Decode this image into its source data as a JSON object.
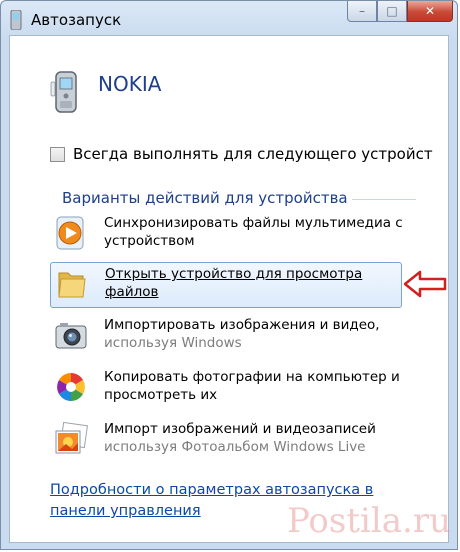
{
  "window": {
    "title": "Автозапуск",
    "caption_buttons": {
      "minimize": "–",
      "maximize": "□",
      "close": "✕"
    }
  },
  "device": {
    "name": "NOKIA",
    "icon": "mobile-phone-icon"
  },
  "always_checkbox": {
    "label": "Всегда выполнять для следующего устройст",
    "checked": false
  },
  "section_title": "Варианты действий для устройства",
  "actions": [
    {
      "line1": "Синхронизировать файлы мультимедиа с",
      "line2": "устройством",
      "icon": "media-player-icon",
      "selected": false
    },
    {
      "line1": "Открыть устройство для просмотра",
      "line2": "файлов",
      "icon": "folder-icon",
      "selected": true
    },
    {
      "line1": "Импортировать изображения и видео,",
      "line2": "используя Windows",
      "icon": "camera-icon",
      "selected": false
    },
    {
      "line1": "Копировать фотографии на компьютер и",
      "line2": "просмотреть их",
      "icon": "picasa-icon",
      "selected": false
    },
    {
      "line1": "Импорт изображений и видеозаписей",
      "line2": "используя Фотоальбом Windows Live",
      "icon": "photo-gallery-icon",
      "selected": false
    }
  ],
  "link": {
    "line1": "Подробности о параметрах автозапуска в",
    "line2": "панели управления"
  },
  "watermark": "Postila.ru",
  "colors": {
    "link": "#0b48a8",
    "heading": "#1e3f8a",
    "highlight": "#dcebfc",
    "arrow": "#d22020"
  }
}
